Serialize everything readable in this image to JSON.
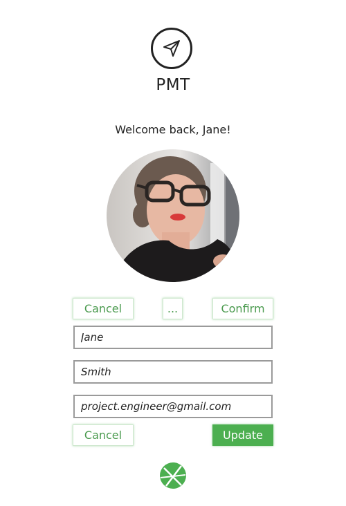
{
  "app": {
    "name": "PMT",
    "logo_icon": "paper-plane-icon"
  },
  "welcome_text": "Welcome back, Jane!",
  "avatar": {
    "alt": "Profile photo of Jane"
  },
  "toolbar": {
    "cancel_label": "Cancel",
    "more_label": "...",
    "confirm_label": "Confirm"
  },
  "form": {
    "first_name": "Jane",
    "last_name": "Smith",
    "email": "project.engineer@gmail.com",
    "cancel_label": "Cancel",
    "update_label": "Update"
  },
  "footer": {
    "icon": "cross-circle-icon"
  },
  "colors": {
    "accent": "#4caf50",
    "text": "#222222",
    "field_border": "#9a9a9a"
  }
}
